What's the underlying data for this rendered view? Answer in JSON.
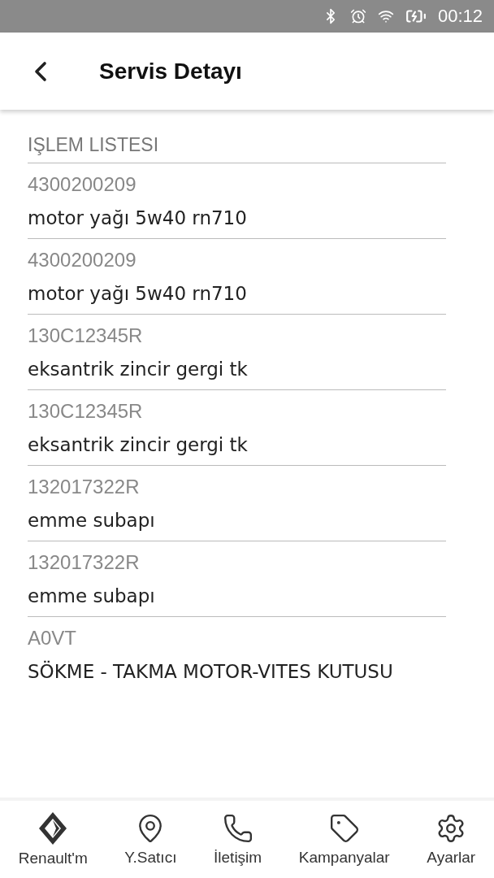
{
  "status_bar": {
    "time": "00:12"
  },
  "header": {
    "title": "Servis Detayı"
  },
  "section_title": "IŞLEM LISTESI",
  "items": [
    {
      "code": "4300200209",
      "name": "motor yağı 5w40 rn710"
    },
    {
      "code": "4300200209",
      "name": "motor yağı 5w40 rn710"
    },
    {
      "code": "130C12345R",
      "name": "eksantrik zincir gergi tk"
    },
    {
      "code": "130C12345R",
      "name": "eksantrik zincir gergi tk"
    },
    {
      "code": "132017322R",
      "name": "emme subapı"
    },
    {
      "code": "132017322R",
      "name": "emme subapı"
    },
    {
      "code": "A0VT",
      "name": "SÖKME - TAKMA MOTOR-VITES KUTUSU"
    }
  ],
  "nav": [
    {
      "kind": "logo",
      "label": "Renault'm"
    },
    {
      "kind": "pin",
      "label": "Y.Satıcı"
    },
    {
      "kind": "phone",
      "label": "İletişim"
    },
    {
      "kind": "tag",
      "label": "Kampanyalar"
    },
    {
      "kind": "gear",
      "label": "Ayarlar"
    }
  ]
}
